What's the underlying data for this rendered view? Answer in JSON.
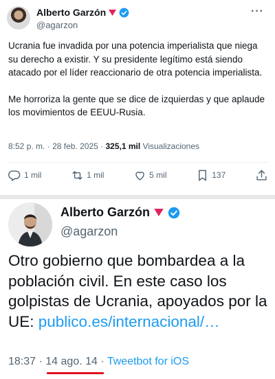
{
  "tweet1": {
    "author_name": "Alberto Garzón",
    "handle": "@agarzon",
    "paragraphs": [
      "Ucrania fue invadida por una potencia imperialista que niega su derecho a existir. Y su presidente legítimo está siendo atacado por el líder reaccionario de otra potencia imperialista.",
      "Me horroriza la gente que se dice de izquierdas y que aplaude los movimientos de EEUU-Rusia."
    ],
    "time": "8:52 p. m.",
    "date": "28 feb. 2025",
    "views_count": "325,1 mil",
    "views_label": "Visualizaciones",
    "replies": "1 mil",
    "retweets": "1 mil",
    "likes": "5 mil",
    "bookmarks": "137",
    "more_symbol": "···",
    "separator": "·"
  },
  "tweet2": {
    "author_name": "Alberto Garzón",
    "handle": "@agarzon",
    "text": "Otro gobierno que bombardea a la población civil. En este caso los golpistas de Ucrania, apoyados por la UE: ",
    "link": "publico.es/internacional/…",
    "time": "18:37",
    "date": "14 ago. 14",
    "source": "Tweetbot for iOS",
    "separator": "·"
  },
  "colors": {
    "accent": "#1d9bf0",
    "badge_pink": "#e0245e",
    "underline_red": "#e0121b",
    "muted": "#536471"
  },
  "icons": [
    "verified-icon",
    "pink-badge-icon",
    "more-icon",
    "reply-icon",
    "retweet-icon",
    "like-icon",
    "bookmark-icon",
    "share-icon"
  ]
}
